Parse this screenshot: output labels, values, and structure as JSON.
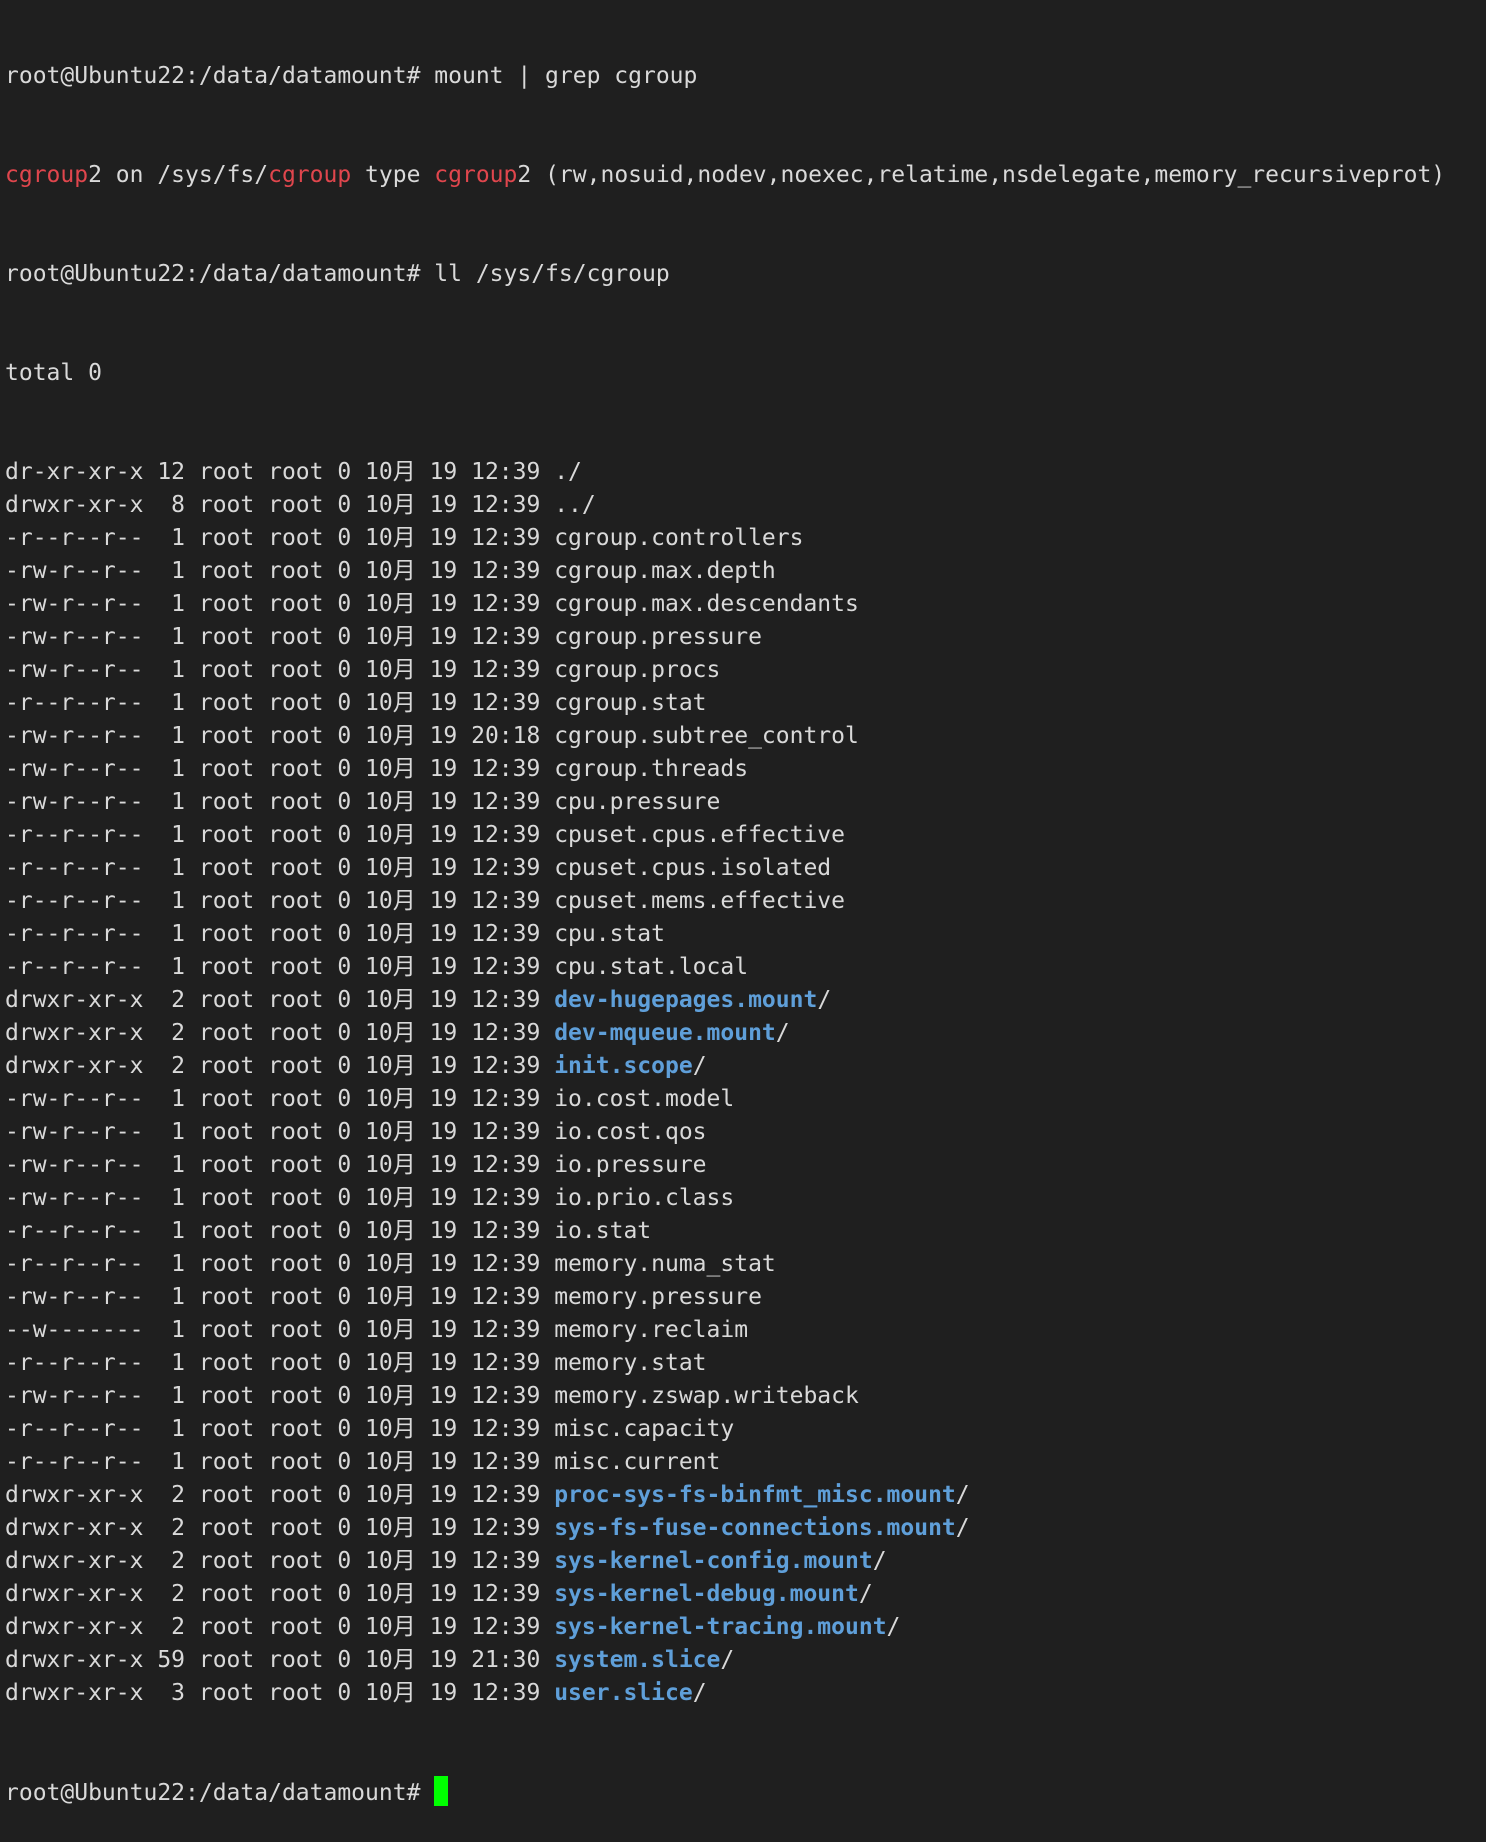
{
  "terminal": {
    "prompt": "root@Ubuntu22:/data/datamount#",
    "cmd1": "mount | grep cgroup",
    "mount_line": {
      "a": "cgroup",
      "b": "2 on /sys/fs/",
      "c": "cgroup",
      "d": " type ",
      "e": "cgroup",
      "f": "2 (rw,nosuid,nodev,noexec,relatime,nsdelegate,memory_recursiveprot)"
    },
    "cmd2": "ll /sys/fs/cgroup",
    "total": "total 0",
    "colors": {
      "background": "#1f1f1f",
      "text": "#d9d9d9",
      "highlight": "#e0464d",
      "directory": "#5f9fd9",
      "cursor": "#00ff00"
    },
    "entries": [
      {
        "prefix": "dr-xr-xr-x 12 root root 0 10月 19 12:39 ",
        "name": "./",
        "type": "dir-self"
      },
      {
        "prefix": "drwxr-xr-x  8 root root 0 10月 19 12:39 ",
        "name": "../",
        "type": "dir-self"
      },
      {
        "prefix": "-r--r--r--  1 root root 0 10月 19 12:39 ",
        "name": "cgroup.controllers",
        "type": "file"
      },
      {
        "prefix": "-rw-r--r--  1 root root 0 10月 19 12:39 ",
        "name": "cgroup.max.depth",
        "type": "file"
      },
      {
        "prefix": "-rw-r--r--  1 root root 0 10月 19 12:39 ",
        "name": "cgroup.max.descendants",
        "type": "file"
      },
      {
        "prefix": "-rw-r--r--  1 root root 0 10月 19 12:39 ",
        "name": "cgroup.pressure",
        "type": "file"
      },
      {
        "prefix": "-rw-r--r--  1 root root 0 10月 19 12:39 ",
        "name": "cgroup.procs",
        "type": "file"
      },
      {
        "prefix": "-r--r--r--  1 root root 0 10月 19 12:39 ",
        "name": "cgroup.stat",
        "type": "file"
      },
      {
        "prefix": "-rw-r--r--  1 root root 0 10月 19 20:18 ",
        "name": "cgroup.subtree_control",
        "type": "file"
      },
      {
        "prefix": "-rw-r--r--  1 root root 0 10月 19 12:39 ",
        "name": "cgroup.threads",
        "type": "file"
      },
      {
        "prefix": "-rw-r--r--  1 root root 0 10月 19 12:39 ",
        "name": "cpu.pressure",
        "type": "file"
      },
      {
        "prefix": "-r--r--r--  1 root root 0 10月 19 12:39 ",
        "name": "cpuset.cpus.effective",
        "type": "file"
      },
      {
        "prefix": "-r--r--r--  1 root root 0 10月 19 12:39 ",
        "name": "cpuset.cpus.isolated",
        "type": "file"
      },
      {
        "prefix": "-r--r--r--  1 root root 0 10月 19 12:39 ",
        "name": "cpuset.mems.effective",
        "type": "file"
      },
      {
        "prefix": "-r--r--r--  1 root root 0 10月 19 12:39 ",
        "name": "cpu.stat",
        "type": "file"
      },
      {
        "prefix": "-r--r--r--  1 root root 0 10月 19 12:39 ",
        "name": "cpu.stat.local",
        "type": "file"
      },
      {
        "prefix": "drwxr-xr-x  2 root root 0 10月 19 12:39 ",
        "name": "dev-hugepages.mount",
        "type": "dir"
      },
      {
        "prefix": "drwxr-xr-x  2 root root 0 10月 19 12:39 ",
        "name": "dev-mqueue.mount",
        "type": "dir"
      },
      {
        "prefix": "drwxr-xr-x  2 root root 0 10月 19 12:39 ",
        "name": "init.scope",
        "type": "dir"
      },
      {
        "prefix": "-rw-r--r--  1 root root 0 10月 19 12:39 ",
        "name": "io.cost.model",
        "type": "file"
      },
      {
        "prefix": "-rw-r--r--  1 root root 0 10月 19 12:39 ",
        "name": "io.cost.qos",
        "type": "file"
      },
      {
        "prefix": "-rw-r--r--  1 root root 0 10月 19 12:39 ",
        "name": "io.pressure",
        "type": "file"
      },
      {
        "prefix": "-rw-r--r--  1 root root 0 10月 19 12:39 ",
        "name": "io.prio.class",
        "type": "file"
      },
      {
        "prefix": "-r--r--r--  1 root root 0 10月 19 12:39 ",
        "name": "io.stat",
        "type": "file"
      },
      {
        "prefix": "-r--r--r--  1 root root 0 10月 19 12:39 ",
        "name": "memory.numa_stat",
        "type": "file"
      },
      {
        "prefix": "-rw-r--r--  1 root root 0 10月 19 12:39 ",
        "name": "memory.pressure",
        "type": "file"
      },
      {
        "prefix": "--w-------  1 root root 0 10月 19 12:39 ",
        "name": "memory.reclaim",
        "type": "file"
      },
      {
        "prefix": "-r--r--r--  1 root root 0 10月 19 12:39 ",
        "name": "memory.stat",
        "type": "file"
      },
      {
        "prefix": "-rw-r--r--  1 root root 0 10月 19 12:39 ",
        "name": "memory.zswap.writeback",
        "type": "file"
      },
      {
        "prefix": "-r--r--r--  1 root root 0 10月 19 12:39 ",
        "name": "misc.capacity",
        "type": "file"
      },
      {
        "prefix": "-r--r--r--  1 root root 0 10月 19 12:39 ",
        "name": "misc.current",
        "type": "file"
      },
      {
        "prefix": "drwxr-xr-x  2 root root 0 10月 19 12:39 ",
        "name": "proc-sys-fs-binfmt_misc.mount",
        "type": "dir"
      },
      {
        "prefix": "drwxr-xr-x  2 root root 0 10月 19 12:39 ",
        "name": "sys-fs-fuse-connections.mount",
        "type": "dir"
      },
      {
        "prefix": "drwxr-xr-x  2 root root 0 10月 19 12:39 ",
        "name": "sys-kernel-config.mount",
        "type": "dir"
      },
      {
        "prefix": "drwxr-xr-x  2 root root 0 10月 19 12:39 ",
        "name": "sys-kernel-debug.mount",
        "type": "dir"
      },
      {
        "prefix": "drwxr-xr-x  2 root root 0 10月 19 12:39 ",
        "name": "sys-kernel-tracing.mount",
        "type": "dir"
      },
      {
        "prefix": "drwxr-xr-x 59 root root 0 10月 19 21:30 ",
        "name": "system.slice",
        "type": "dir"
      },
      {
        "prefix": "drwxr-xr-x  3 root root 0 10月 19 12:39 ",
        "name": "user.slice",
        "type": "dir"
      }
    ]
  }
}
